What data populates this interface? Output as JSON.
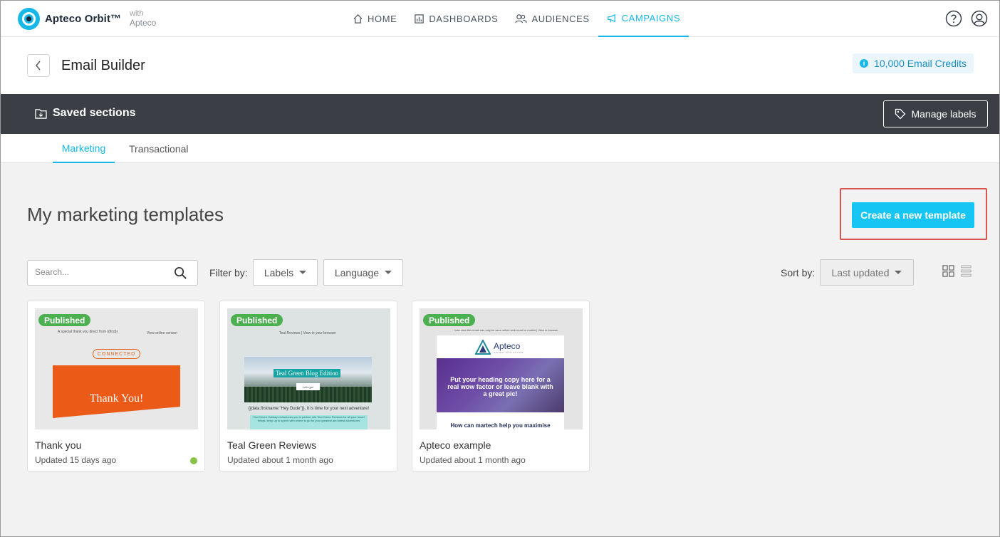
{
  "app": {
    "brand": "Apteco Orbit™",
    "with_line1": "with",
    "with_line2": "Apteco"
  },
  "nav": [
    {
      "label": "HOME",
      "icon": "home-icon"
    },
    {
      "label": "DASHBOARDS",
      "icon": "dashboard-icon"
    },
    {
      "label": "AUDIENCES",
      "icon": "users-icon"
    },
    {
      "label": "CAMPAIGNS",
      "icon": "megaphone-icon",
      "active": true
    }
  ],
  "header": {
    "title": "Email Builder",
    "credits": "10,000 Email Credits"
  },
  "toolbar": {
    "saved_sections": "Saved sections",
    "manage_labels": "Manage labels"
  },
  "tabs": [
    {
      "label": "Marketing",
      "active": true
    },
    {
      "label": "Transactional",
      "active": false
    }
  ],
  "main": {
    "title": "My marketing templates",
    "create_button": "Create a new template",
    "search_placeholder": "Search...",
    "filter_by": "Filter by:",
    "labels_dropdown": "Labels",
    "language_dropdown": "Language",
    "sort_by": "Sort by:",
    "sort_value": "Last updated"
  },
  "templates": [
    {
      "status": "Published",
      "name": "Thank you",
      "updated": "Updated 15 days ago",
      "preview": {
        "line1": "A special thank you direct from {{first}}",
        "line2": "View online version",
        "logo": "CONNECTED",
        "hero": "Thank You!"
      }
    },
    {
      "status": "Published",
      "name": "Teal Green Reviews",
      "updated": "Updated about 1 month ago",
      "preview": {
        "header": "Teal Reviews | View in your browser",
        "banner": "Teal Green Blog Edition",
        "button": "Let's go!",
        "greeting": "{{data.firstname:\"Hey Dude\"}}, It is time for your next adventure!",
        "body": "Teal Green Holidays introduces you to partner site Teal Green Reviews for all your travel things, keep up to speed with where to go for your greatest and latest adventures"
      }
    },
    {
      "status": "Published",
      "name": "Apteco example",
      "updated": "Updated about 1 month ago",
      "preview": {
        "header": "I can view this email can only be seen within web email or mobile | View in browser",
        "logo": "Apteco",
        "tagline": "INSIGHT INTO ACTION",
        "hero": "Put your heading copy here for a real wow factor or leave blank with a great pic!",
        "sub": "How can martech help you maximise"
      }
    }
  ],
  "colors": {
    "accent": "#16b8e8",
    "button": "#16c5f3",
    "published": "#4caf50",
    "darkbar": "#3b3f45",
    "highlight": "#d9534f"
  }
}
